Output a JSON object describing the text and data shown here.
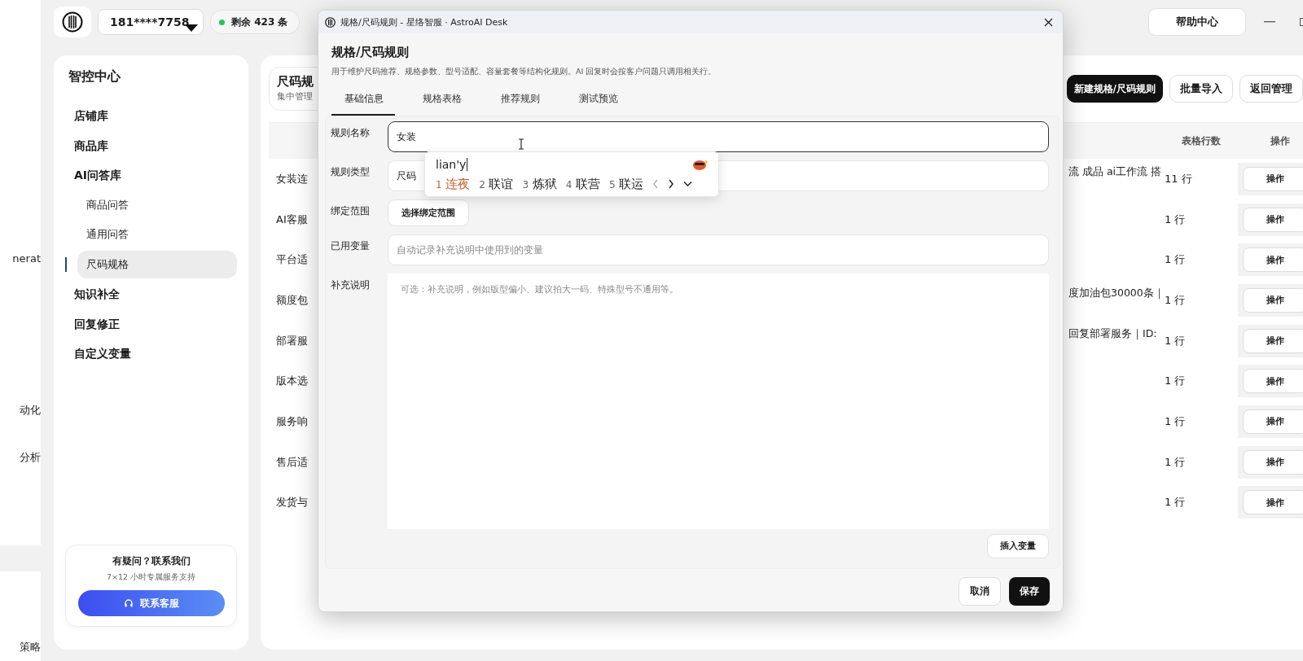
{
  "background_window": {
    "fragments": [
      "nerat",
      "动化",
      "分析",
      "策略"
    ]
  },
  "header": {
    "account": "181****7758",
    "quota": "剩余 423 条",
    "help": "帮助中心"
  },
  "sidebar": {
    "title": "智控中心",
    "items": [
      {
        "label": "店铺库",
        "selected": false
      },
      {
        "label": "商品库",
        "selected": false
      },
      {
        "label": "AI问答库",
        "selected": false,
        "children": [
          {
            "label": "商品问答",
            "selected": false
          },
          {
            "label": "通用问答",
            "selected": false
          },
          {
            "label": "尺码规格",
            "selected": true
          }
        ]
      },
      {
        "label": "知识补全",
        "selected": false
      },
      {
        "label": "回复修正",
        "selected": false
      },
      {
        "label": "自定义变量",
        "selected": false
      }
    ],
    "contact": {
      "title": "有疑问？联系我们",
      "subtitle": "7×12 小时专属服务支持",
      "button": "联系客服"
    }
  },
  "page": {
    "title": "尺码规",
    "subtitle": "集中管理",
    "buttons": [
      {
        "label": "新建规格/尺码规则",
        "primary": true
      },
      {
        "label": "批量导入",
        "primary": false
      },
      {
        "label": "返回管理",
        "primary": false
      }
    ],
    "table": {
      "columns": [
        "表格行数",
        "操作"
      ],
      "rows": [
        {
          "name": "女装连",
          "detail": "流 成品 ai工作流 搭",
          "count": "11 行",
          "action": "操作"
        },
        {
          "name": "AI客服",
          "count": "1 行",
          "action": "操作"
        },
        {
          "name": "平台适",
          "count": "1 行",
          "action": "操作"
        },
        {
          "name": "额度包",
          "detail": "度加油包30000条｜",
          "count": "1 行",
          "action": "操作"
        },
        {
          "name": "部署服",
          "detail": "回复部署服务｜ID:",
          "count": "1 行",
          "action": "操作"
        },
        {
          "name": "版本选",
          "count": "1 行",
          "action": "操作"
        },
        {
          "name": "服务响",
          "count": "1 行",
          "action": "操作"
        },
        {
          "name": "售后适",
          "count": "1 行",
          "action": "操作"
        },
        {
          "name": "发货与",
          "count": "1 行",
          "action": "操作"
        }
      ]
    }
  },
  "dialog": {
    "title": "规格/尺码规则 - 星络智服 · AstroAI Desk",
    "heading": "规格/尺码规则",
    "description": "用于维护尺码推荐、规格参数、型号适配、容量套餐等结构化规则。AI 回复时会按客户问题只调用相关行。",
    "tabs": [
      {
        "label": "基础信息",
        "selected": true
      },
      {
        "label": "规格表格",
        "selected": false
      },
      {
        "label": "推荐规则",
        "selected": false
      },
      {
        "label": "测试预览",
        "selected": false
      }
    ],
    "fields": [
      {
        "label": "规则名称",
        "kind": "input",
        "value": "女装",
        "focused": true
      },
      {
        "label": "规则类型",
        "kind": "input",
        "value": "尺码",
        "focused": false
      },
      {
        "label": "绑定范围",
        "kind": "button",
        "button": "选择绑定范围"
      },
      {
        "label": "已用变量",
        "kind": "input",
        "placeholder": "自动记录补充说明中使用到的变量",
        "focused": false
      },
      {
        "label": "补充说明",
        "kind": "textarea",
        "placeholder": "可选：补充说明，例如版型偏小、建议拍大一码、特殊型号不通用等。"
      }
    ],
    "insert_button": "插入变量",
    "cancel": "取消",
    "save": "保存",
    "ime": {
      "composition": "lian'y",
      "candidates": [
        {
          "index": "1",
          "text": "连夜",
          "selected": true
        },
        {
          "index": "2",
          "text": "联谊",
          "selected": false
        },
        {
          "index": "3",
          "text": "炼狱",
          "selected": false
        },
        {
          "index": "4",
          "text": "联营",
          "selected": false
        },
        {
          "index": "5",
          "text": "联运",
          "selected": false
        }
      ]
    }
  }
}
